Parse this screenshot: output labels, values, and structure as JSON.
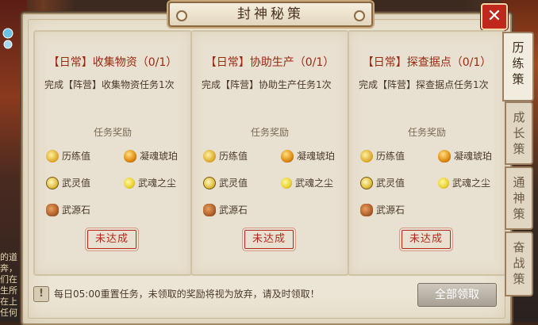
{
  "title": "封神秘策",
  "scene_text": [
    "的道",
    "奔，",
    "们在",
    "生所",
    "在上",
    "任何"
  ],
  "cards": [
    {
      "title": "【日常】收集物资（0/1）",
      "desc": "完成【阵营】收集物资任务1次",
      "reward_head": "任务奖励",
      "rewards": [
        "历练值",
        "凝魂琥珀",
        "武灵值",
        "武魂之尘",
        "武源石"
      ],
      "status": "未达成"
    },
    {
      "title": "【日常】协助生产（0/1）",
      "desc": "完成【阵营】协助生产任务1次",
      "reward_head": "任务奖励",
      "rewards": [
        "历练值",
        "凝魂琥珀",
        "武灵值",
        "武魂之尘",
        "武源石"
      ],
      "status": "未达成"
    },
    {
      "title": "【日常】探查据点（0/1）",
      "desc": "完成【阵营】探查据点任务1次",
      "reward_head": "任务奖励",
      "rewards": [
        "历练值",
        "凝魂琥珀",
        "武灵值",
        "武魂之尘",
        "武源石"
      ],
      "status": "未达成"
    }
  ],
  "tabs": [
    {
      "chars": [
        "历",
        "练",
        "策"
      ],
      "active": true
    },
    {
      "chars": [
        "成",
        "长",
        "策"
      ],
      "active": false
    },
    {
      "chars": [
        "通",
        "神",
        "策"
      ],
      "active": false
    },
    {
      "chars": [
        "奋",
        "战",
        "策"
      ],
      "active": false
    }
  ],
  "footer": {
    "warn_symbol": "!",
    "notice": "每日05:00重置任务，未领取的奖励将视为放弃，请及时领取！",
    "claim_all": "全部领取"
  },
  "close_symbol": "✕",
  "icons": {
    "reward_1": "lilian-icon",
    "reward_2": "amber-icon",
    "reward_3": "wuling-coin-icon",
    "reward_4": "soul-dust-icon",
    "reward_5": "wuyuan-stone-icon"
  }
}
